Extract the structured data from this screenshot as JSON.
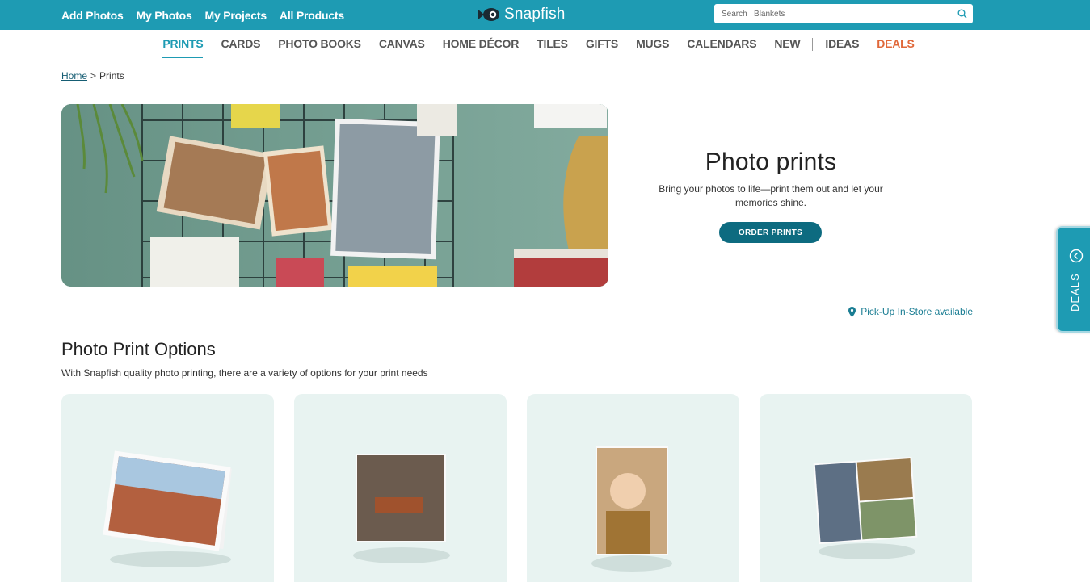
{
  "header": {
    "nav": [
      "Add Photos",
      "My Photos",
      "My Projects",
      "All Products"
    ],
    "logo_text": "Snapfish",
    "search_placeholder": "Search   Blankets"
  },
  "categories": [
    {
      "label": "PRINTS",
      "active": true
    },
    {
      "label": "CARDS"
    },
    {
      "label": "PHOTO BOOKS"
    },
    {
      "label": "CANVAS"
    },
    {
      "label": "HOME DÉCOR"
    },
    {
      "label": "TILES"
    },
    {
      "label": "GIFTS"
    },
    {
      "label": "MUGS"
    },
    {
      "label": "CALENDARS"
    },
    {
      "label": "NEW"
    },
    {
      "label": "IDEAS"
    },
    {
      "label": "DEALS",
      "highlight": true
    }
  ],
  "breadcrumb": {
    "home": "Home",
    "sep": ">",
    "current": "Prints"
  },
  "hero": {
    "title": "Photo prints",
    "subtitle": "Bring your photos to life—print them out and let your memories shine.",
    "cta": "ORDER PRINTS"
  },
  "pickup": "Pick-Up In-Store available",
  "options": {
    "title": "Photo Print Options",
    "subtitle": "With Snapfish quality photo printing, there are a variety of options for your print needs"
  },
  "deals_tab": "DEALS",
  "colors": {
    "brand": "#1e9bb3",
    "button": "#0d6b80",
    "deals": "#e0683a",
    "card_bg": "#e8f3f1"
  }
}
